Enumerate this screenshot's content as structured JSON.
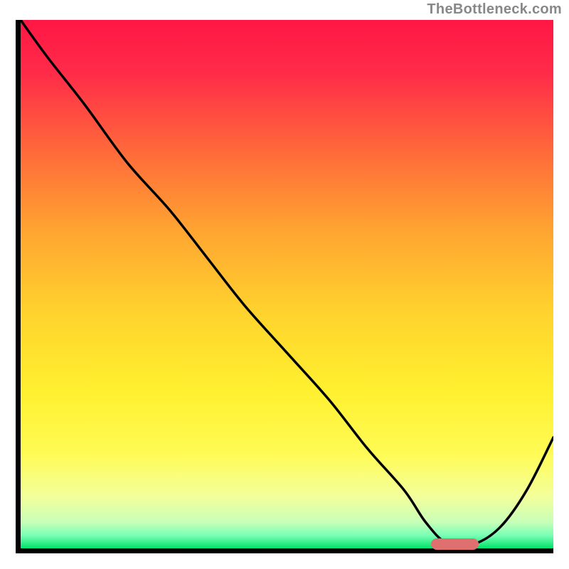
{
  "attribution": "TheBottleneck.com",
  "colors": {
    "curve": "#000000",
    "marker": "#e07070",
    "axis": "#000000"
  },
  "chart_data": {
    "type": "line",
    "title": "",
    "xlabel": "",
    "ylabel": "",
    "xlim": [
      0,
      100
    ],
    "ylim": [
      0,
      100
    ],
    "series": [
      {
        "name": "bottleneck-curve",
        "x": [
          0,
          5,
          12,
          20,
          28,
          35,
          42,
          50,
          58,
          65,
          72,
          76,
          80,
          85,
          90,
          95,
          100
        ],
        "y": [
          100,
          93,
          84,
          73,
          64,
          55,
          46,
          37,
          28,
          19,
          11,
          5,
          1,
          0.8,
          4,
          11,
          21
        ]
      }
    ],
    "marker": {
      "x_start": 77,
      "x_end": 86,
      "y": 0.8,
      "height_pct": 2.2
    },
    "gradient_stops": [
      {
        "offset": 0.0,
        "color": "#ff1744"
      },
      {
        "offset": 0.1,
        "color": "#ff2b49"
      },
      {
        "offset": 0.25,
        "color": "#ff6a3a"
      },
      {
        "offset": 0.4,
        "color": "#ffa531"
      },
      {
        "offset": 0.55,
        "color": "#ffd22e"
      },
      {
        "offset": 0.7,
        "color": "#fff02f"
      },
      {
        "offset": 0.82,
        "color": "#fffb55"
      },
      {
        "offset": 0.9,
        "color": "#f4ff9a"
      },
      {
        "offset": 0.95,
        "color": "#c9ffb8"
      },
      {
        "offset": 0.975,
        "color": "#7bffb6"
      },
      {
        "offset": 1.0,
        "color": "#00e36a"
      }
    ]
  }
}
